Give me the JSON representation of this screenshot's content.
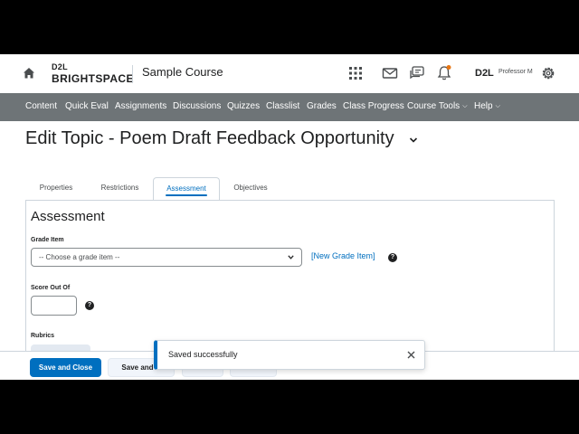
{
  "header": {
    "brand_top": "D2L",
    "brand_name": "BRIGHTSPACE",
    "course_title": "Sample Course",
    "org_logo": "D2L",
    "user_name": "Professor M",
    "icons": [
      "home-icon",
      "waffle-grid-icon",
      "mail-icon",
      "chat-icon",
      "bell-icon",
      "gear-icon"
    ],
    "notification_dot_color": "#e87511"
  },
  "nav": {
    "items": [
      "Content",
      "Quick Eval",
      "Assignments",
      "Discussions",
      "Quizzes",
      "Classlist",
      "Grades",
      "Class Progress",
      "Course Tools",
      "Help"
    ],
    "bg_color": "#6e7477"
  },
  "page": {
    "title": "Edit Topic - Poem Draft Feedback Opportunity"
  },
  "tabs": [
    "Properties",
    "Restrictions",
    "Assessment",
    "Objectives"
  ],
  "active_tab": "Assessment",
  "assessment": {
    "heading": "Assessment",
    "grade_item_label": "Grade Item",
    "grade_item_value": "-- Choose a grade item --",
    "new_grade_item_link": "[New Grade Item]",
    "score_out_of_label": "Score Out Of",
    "score_out_of_value": "",
    "rubrics_label": "Rubrics"
  },
  "buttons": {
    "save_and_close": "Save and Close",
    "save_and_new": "Save and N"
  },
  "toast": {
    "message": "Saved successfully"
  },
  "colors": {
    "accent": "#006fbf",
    "text": "#202122"
  }
}
